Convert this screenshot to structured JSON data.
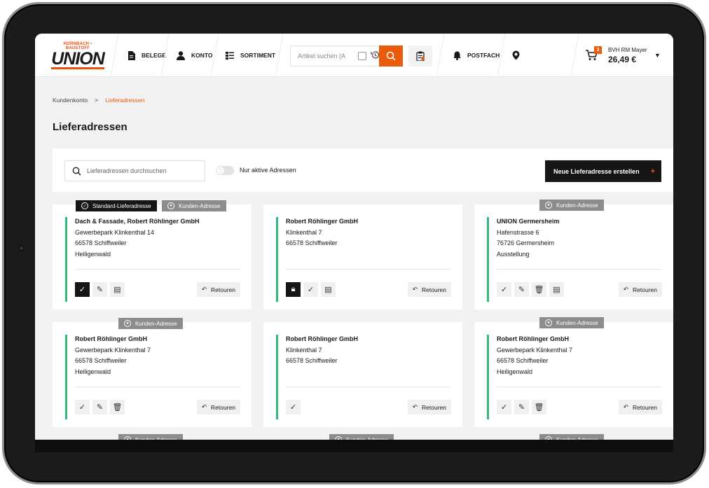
{
  "header": {
    "logo_top": "HORNBACH ▪ BAUSTOFF",
    "logo_main": "UNION",
    "nav": [
      {
        "label": "BELEGE"
      },
      {
        "label": "KONTO"
      },
      {
        "label": "SORTIMENT"
      }
    ],
    "search_placeholder": "Artikel suchen (A",
    "postfach": "POSTFACH",
    "cart_count": "3",
    "cart_user": "BVH RM Mayer",
    "cart_total": "26,49 €"
  },
  "breadcrumb": {
    "root": "Kundenkonto",
    "sep": ">",
    "current": "Lieferadressen"
  },
  "page_title": "Lieferadressen",
  "toolbar": {
    "filter_placeholder": "Lieferadressen durchsuchen",
    "toggle_label": "Nur aktive Adressen",
    "new_button": "Neue Lieferadresse erstellen",
    "new_plus": "+"
  },
  "tags": {
    "standard": "Standard-Lieferadresse",
    "kunden": "Kunden-Adresse"
  },
  "retour_label": "Retouren",
  "cards": [
    {
      "l1": "Dach & Fassade, Robert Röhlinger GmbH",
      "l2": "Gewerbepark Klinkenthal 14",
      "l3": "66578 Schiffweiler",
      "l4": "Heiligenwald"
    },
    {
      "l1": "Robert Röhlinger GmbH",
      "l2": "Klinkenthal 7",
      "l3": "66578 Schiffweiler",
      "l4": ""
    },
    {
      "l1": "UNION Germersheim",
      "l2": "Hafenstrasse 6",
      "l3": "76726 Germersheim",
      "l4": "Ausstellung"
    },
    {
      "l1": "Robert Röhlinger GmbH",
      "l2": "Gewerbepark Klinkenthal 7",
      "l3": "66578 Schiffweiler",
      "l4": "Heiligenwald"
    },
    {
      "l1": "Robert Röhlinger GmbH",
      "l2": "Klinkenthal 7",
      "l3": "66578 Schiffweiler",
      "l4": ""
    },
    {
      "l1": "Robert Röhlinger GmbH",
      "l2": "Gewerbepark Klinkenthal 7",
      "l3": "66578 Schiffweiler",
      "l4": "Heiligenwald"
    }
  ],
  "colors": {
    "accent": "#ea5b0c",
    "status_bar": "#2fba7c",
    "dark": "#161616"
  }
}
